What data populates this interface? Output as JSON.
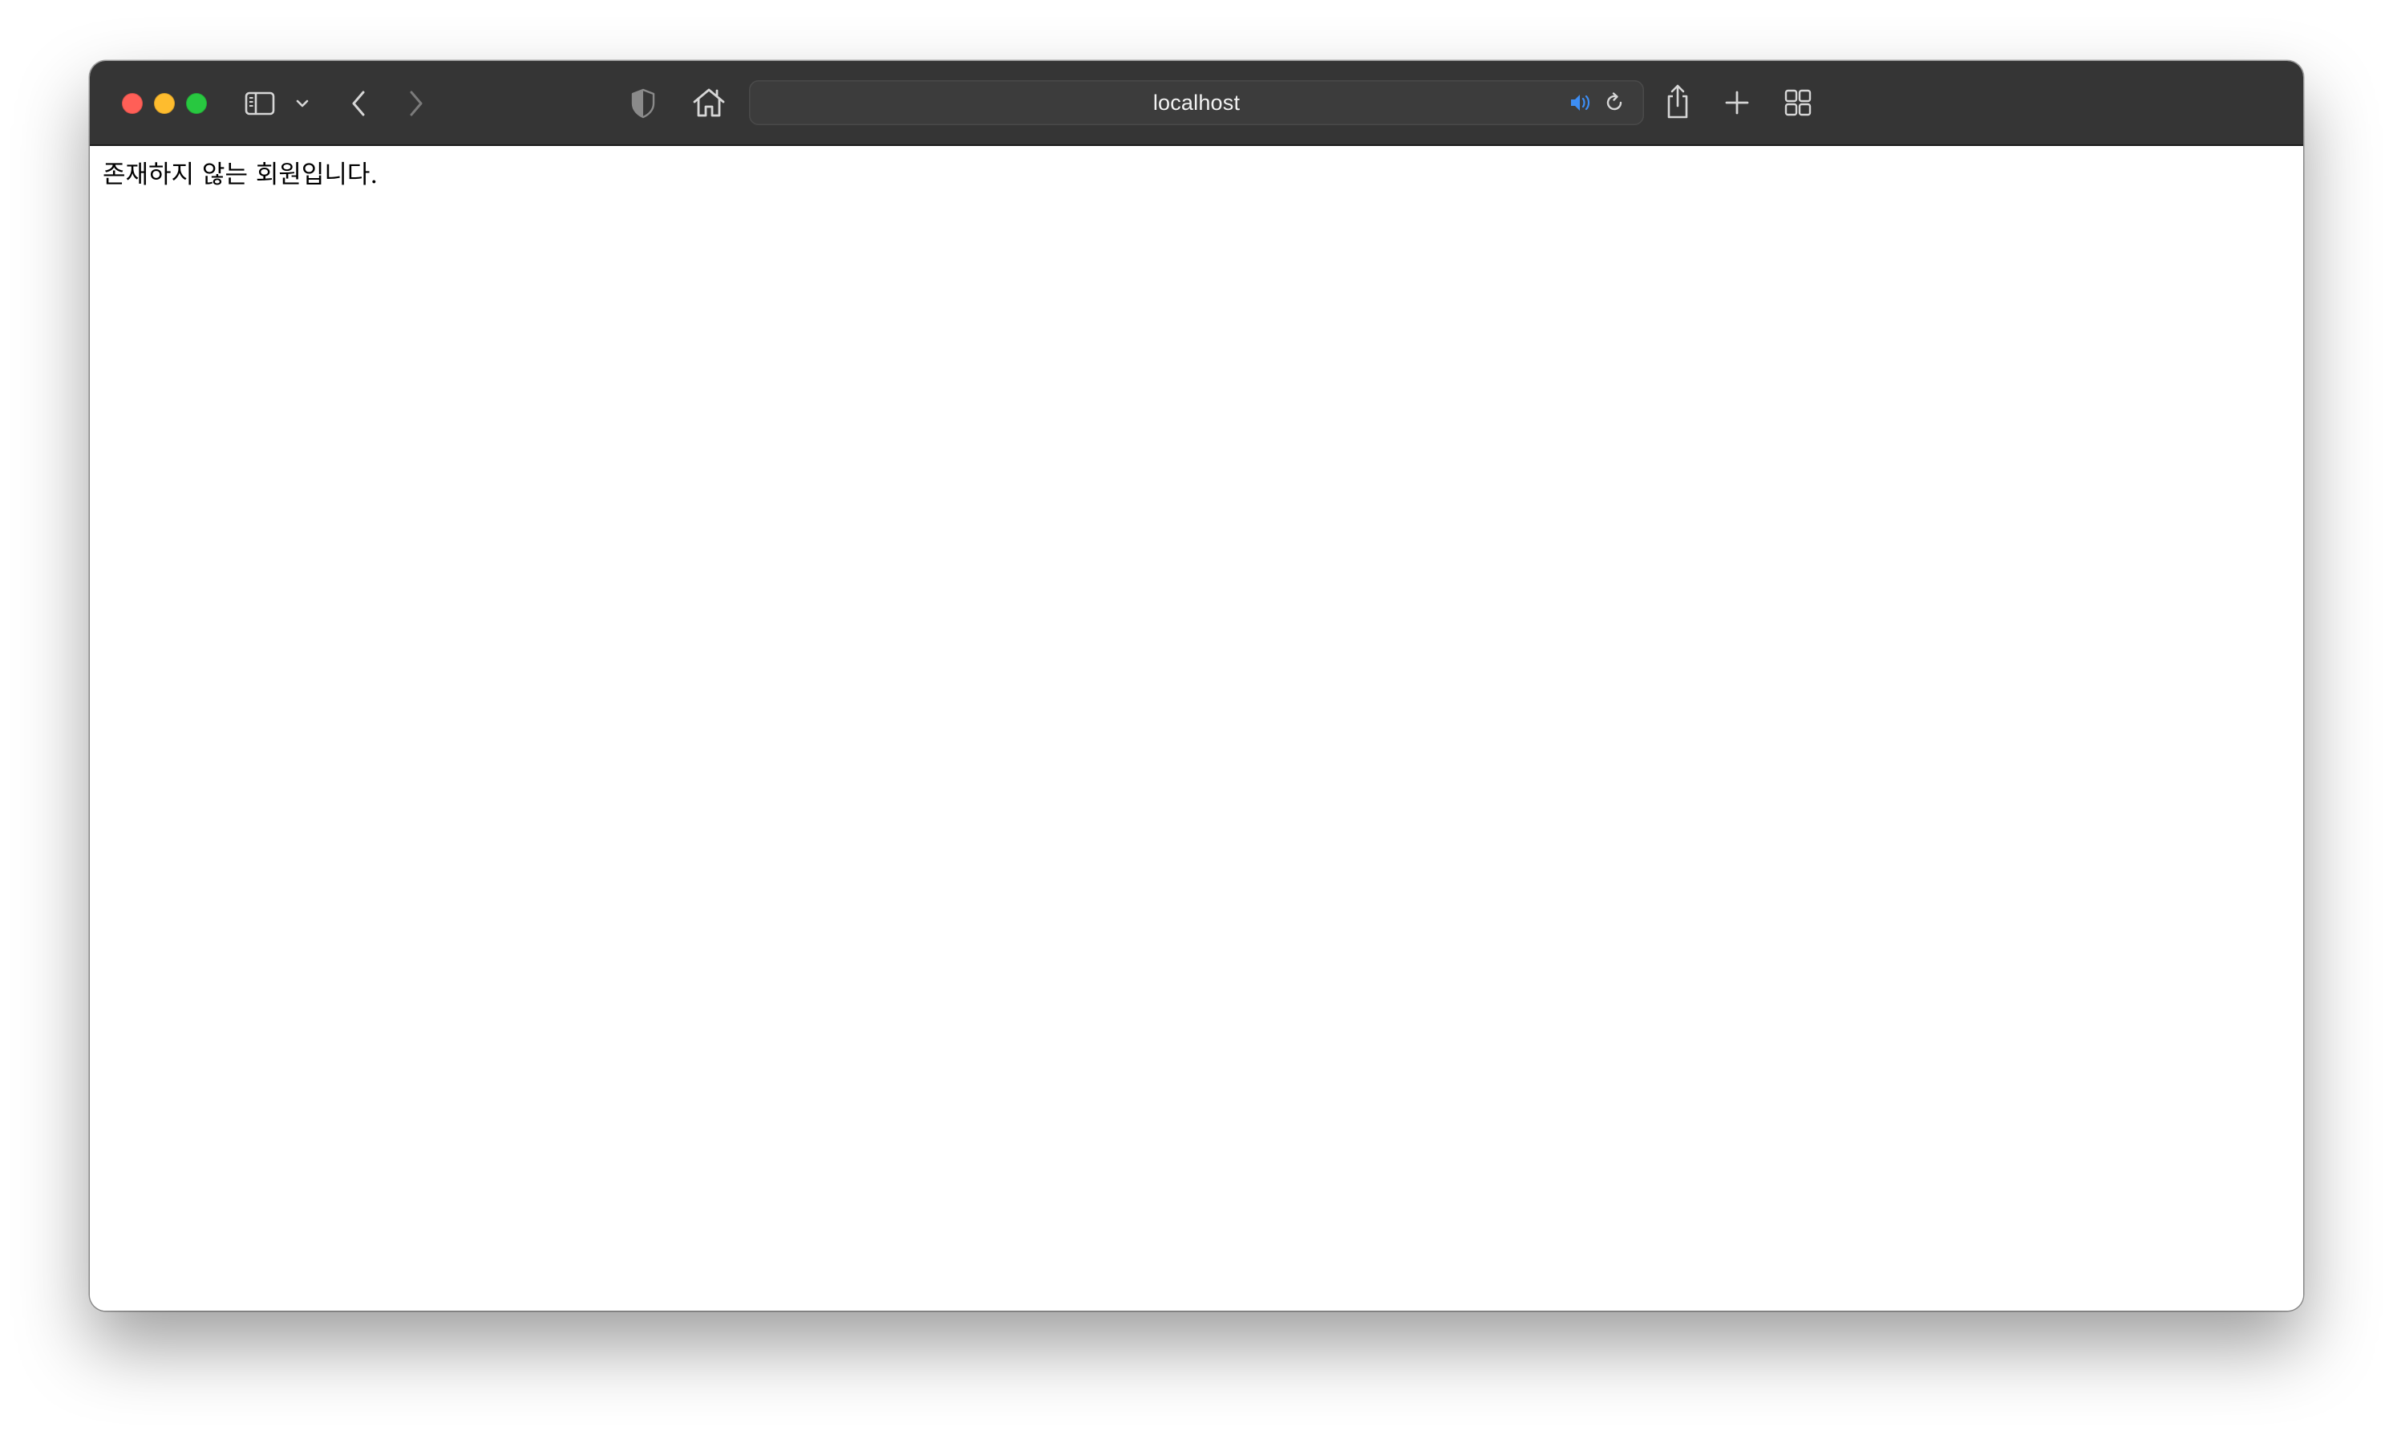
{
  "browser": {
    "address_bar": {
      "url": "localhost"
    },
    "icons": {
      "sidebar": "sidebar-icon",
      "sidebar_menu": "chevron-down-icon",
      "back": "chevron-left-icon",
      "forward": "chevron-right-icon",
      "privacy": "shield-icon",
      "home": "home-icon",
      "audio": "speaker-icon",
      "reload": "reload-icon",
      "share": "share-icon",
      "new_tab": "plus-icon",
      "tab_overview": "grid-icon"
    },
    "colors": {
      "toolbar": "#353535",
      "audio_accent": "#3d8ef5",
      "close": "#ff5f57",
      "minimize": "#febc2e",
      "zoom": "#28c840"
    }
  },
  "page": {
    "message": "존재하지 않는 회원입니다."
  }
}
